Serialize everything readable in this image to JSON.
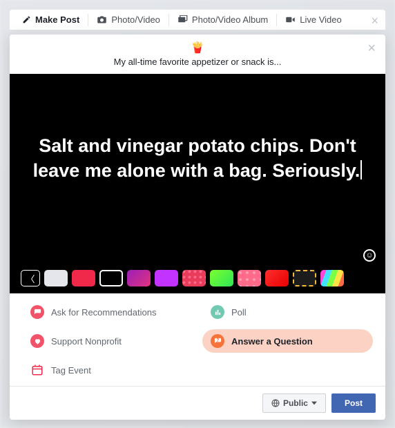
{
  "tabs": {
    "make_post": "Make Post",
    "photo_video": "Photo/Video",
    "album": "Photo/Video Album",
    "live": "Live Video"
  },
  "prompt": {
    "emoji": "🍟",
    "text": "My all-time favorite appetizer or snack is..."
  },
  "canvas": {
    "text": "Salt and vinegar potato chips. Don't leave me alone with a bag. Seriously."
  },
  "swatches": [
    {
      "bg": "#e4e6eb",
      "selected": false
    },
    {
      "bg": "#f02849",
      "selected": false
    },
    {
      "bg": "#000000",
      "selected": true
    },
    {
      "bg": "linear-gradient(135deg,#9b1fb8,#e0337e)",
      "selected": false
    },
    {
      "bg": "#c233ff",
      "selected": false
    },
    {
      "bg": "radial-gradient(circle at 30% 30%,#ff6b8a 2px,#e93b5a 2px) 0 0/8px 8px",
      "selected": false
    },
    {
      "bg": "linear-gradient(135deg,#7cff2e,#2ee657)",
      "selected": false
    },
    {
      "bg": "radial-gradient(circle at 40% 40%,#ff9eb0 2px,#ff6b8a 2px) 0 0/10px 10px",
      "selected": false
    },
    {
      "bg": "linear-gradient(135deg,#ff2e2e,#e60000)",
      "selected": false
    },
    {
      "bg": "#1c1c1c",
      "border": "2px dashed #f5b942",
      "selected": false
    },
    {
      "bg": "linear-gradient(110deg,#ff46d6 0 20%,#42e3ff 20% 40%,#7aff46 40% 60%,#ffe346 60% 80%,#ff6b46 80%)",
      "selected": false
    }
  ],
  "options": {
    "recommendations": "Ask for Recommendations",
    "poll": "Poll",
    "nonprofit": "Support Nonprofit",
    "answer": "Answer a Question",
    "tag_event": "Tag Event"
  },
  "footer": {
    "privacy": "Public",
    "post": "Post"
  }
}
